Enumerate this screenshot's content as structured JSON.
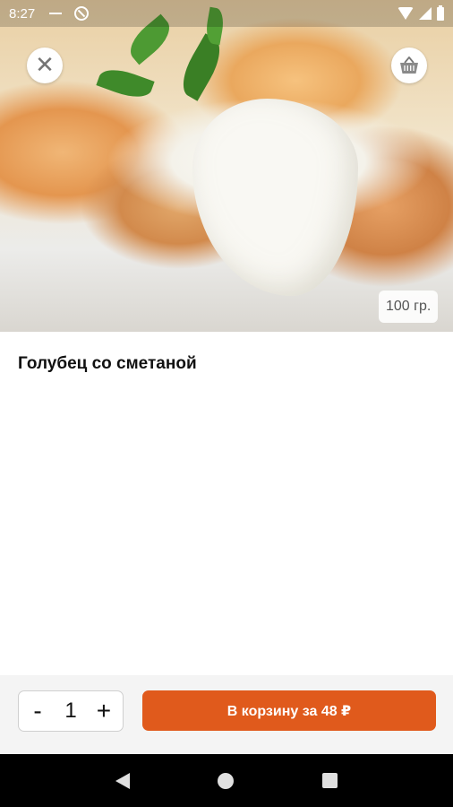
{
  "status_bar": {
    "time": "8:27"
  },
  "product": {
    "title": "Голубец со сметаной",
    "weight": "100 гр."
  },
  "header": {
    "close_icon": "close-icon",
    "basket_icon": "basket-icon"
  },
  "order": {
    "minus_label": "-",
    "quantity": "1",
    "plus_label": "+",
    "add_to_cart_label": "В корзину за 48 ₽"
  },
  "colors": {
    "accent": "#e05a1c",
    "action_bar_bg": "#f4f4f4"
  },
  "nav": {
    "back_icon": "back-triangle-icon",
    "home_icon": "home-circle-icon",
    "recents_icon": "recents-square-icon"
  }
}
